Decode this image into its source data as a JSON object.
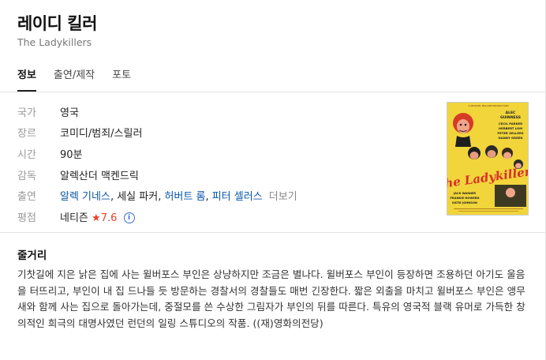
{
  "header": {
    "title": "레이디 킬러",
    "original_title": "The Ladykillers"
  },
  "tabs": [
    {
      "label": "정보",
      "active": true
    },
    {
      "label": "출연/제작",
      "active": false
    },
    {
      "label": "포토",
      "active": false
    }
  ],
  "info": {
    "country": {
      "label": "국가",
      "value": "영국"
    },
    "genre": {
      "label": "장르",
      "value": "코미디/범죄/스릴러"
    },
    "runtime": {
      "label": "시간",
      "value": "90분"
    },
    "director": {
      "label": "감독",
      "value": "알렉산더 맥켄드릭"
    },
    "cast": {
      "label": "출연",
      "members": [
        "알렉 기네스",
        "세실 파커",
        "허버트 롬",
        "피터 셀러스"
      ],
      "linked": [
        true,
        false,
        true,
        true
      ],
      "more": "더보기"
    },
    "rating": {
      "label": "평점",
      "source": "네티즌",
      "star": "★",
      "score": "7.6",
      "info_glyph": "i"
    }
  },
  "poster": {
    "top_text": "A MICHAEL BALCON PRODUCTION",
    "credits": [
      "ALEC",
      "GUINNESS",
      "CECIL  PARKER",
      "HERBERT LOM",
      "PETER SELLERS",
      "DANNY GREEN"
    ],
    "logo": "The Ladykillers",
    "bottom_credits": [
      "JACK WARNER",
      "FRANKIE HOWERD",
      "KATIE JOHNSON"
    ]
  },
  "plot": {
    "heading": "줄거리",
    "text": "기찻길에 지은 낡은 집에 사는 윌버포스 부인은 상냥하지만 조금은 별나다. 윌버포스 부인이 등장하면 조용하던 아기도 울음을 터뜨리고, 부인이 내 집 드나들 듯 방문하는 경찰서의 경찰들도 매번 긴장한다. 짧은 외출을 마치고 윌버포스 부인은 앵무새와 함께 사는 집으로 돌아가는데, 중절모를 쓴 수상한 그림자가 부인의 뒤를 따른다. 특유의 영국적 블랙 유머로 가득한 창의적인 희극의 대명사였던 런던의 일링 스튜디오의 작품. ((재)영화의전당)"
  },
  "colors": {
    "link": "#0b55a8",
    "rating_star": "#e8412a",
    "poster_bg": "#f1d53a"
  }
}
